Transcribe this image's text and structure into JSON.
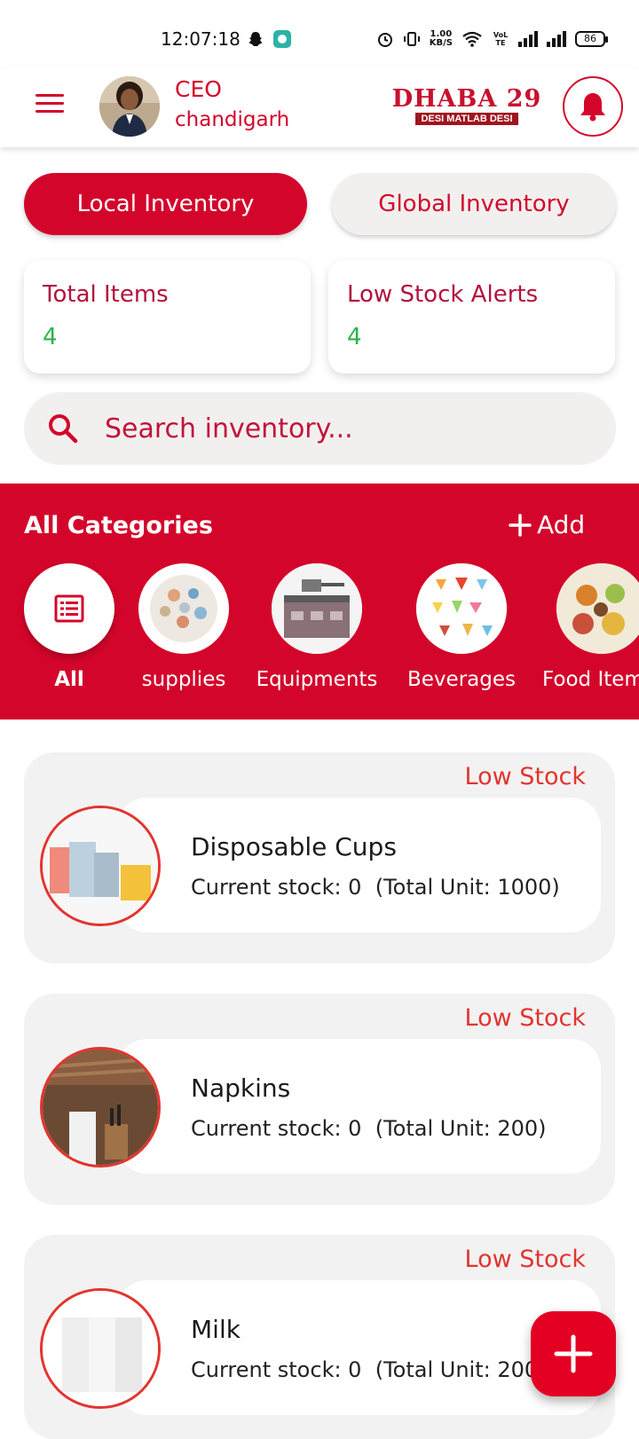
{
  "status_bar": {
    "time": "12:07:18",
    "net_speed_value": "1.00",
    "net_speed_unit": "KB/S",
    "volte": "VoLTE",
    "battery": "86"
  },
  "header": {
    "role": "CEO",
    "city": "chandigarh",
    "logo_text": "DHABA 29",
    "logo_tagline": "DESI MATLAB DESI"
  },
  "tabs": {
    "local": "Local Inventory",
    "global": "Global Inventory"
  },
  "stats": {
    "total_label": "Total Items",
    "total_value": "4",
    "low_label": "Low Stock Alerts",
    "low_value": "4"
  },
  "search": {
    "placeholder": "Search inventory..."
  },
  "categories": {
    "title": "All Categories",
    "add_label": "Add",
    "items": [
      {
        "label": "All"
      },
      {
        "label": "supplies"
      },
      {
        "label": "Equipments"
      },
      {
        "label": "Beverages"
      },
      {
        "label": "Food Item"
      }
    ]
  },
  "inventory": [
    {
      "badge": "Low Stock",
      "name": "Disposable Cups",
      "stock": "Current stock: 0  (Total Unit: 1000)"
    },
    {
      "badge": "Low Stock",
      "name": "Napkins",
      "stock": "Current stock: 0  (Total Unit: 200)"
    },
    {
      "badge": "Low Stock",
      "name": "Milk",
      "stock": "Current stock: 0  (Total Unit: 200"
    }
  ],
  "colors": {
    "primary": "#d4052b",
    "success": "#2cb34a",
    "alert": "#e3342f"
  }
}
